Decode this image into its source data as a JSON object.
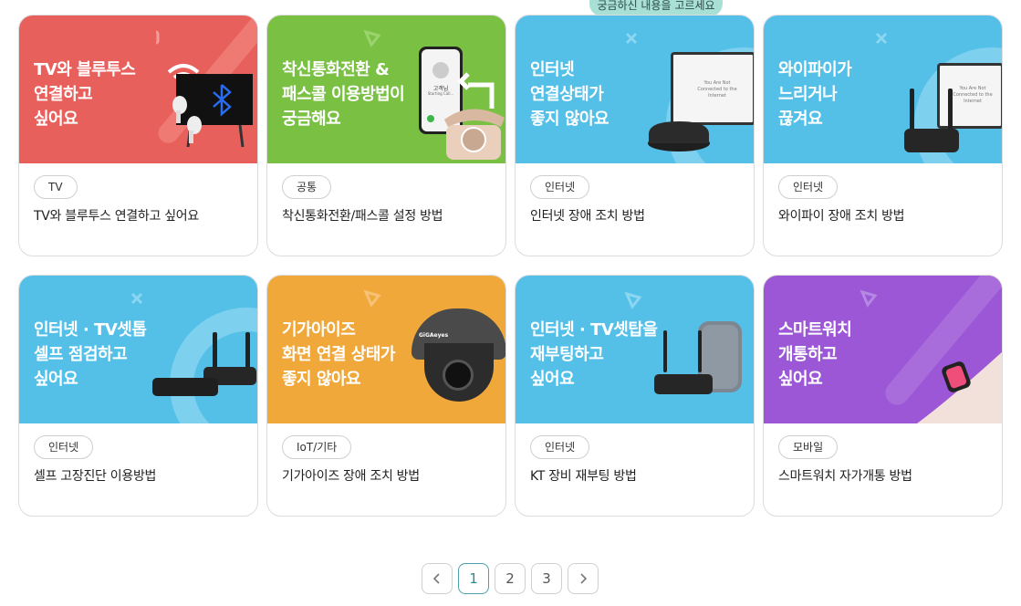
{
  "tooltip": {
    "text": "궁금하신 내용을 고르세요"
  },
  "cards": [
    {
      "title": "TV와 블루투스\n연결하고\n싶어요",
      "tag": "TV",
      "desc": "TV와 블루투스 연결하고 싶어요",
      "bg": "#e8605b"
    },
    {
      "title": "착신통화전환 &\n패스콜 이용방법이\n궁금해요",
      "tag": "공통",
      "desc": "착신통화전환/패스콜 설정 방법",
      "bg": "#79c043",
      "phone_name": "고객님",
      "phone_status": "Starting Call..."
    },
    {
      "title": "인터넷\n연결상태가\n좋지 않아요",
      "tag": "인터넷",
      "desc": "인터넷 장애 조치 방법",
      "bg": "#54c0e8",
      "screen_text": "You Are Not Connected to the Internet"
    },
    {
      "title": "와이파이가\n느리거나\n끊겨요",
      "tag": "인터넷",
      "desc": "와이파이 장애 조치 방법",
      "bg": "#54c0e8",
      "screen_text": "You Are Not Connected to the Internet"
    },
    {
      "title": "인터넷 · TV셋톱\n셀프 점검하고\n싶어요",
      "tag": "인터넷",
      "desc": "셀프 고장진단 이용방법",
      "bg": "#54c0e8"
    },
    {
      "title": "기가아이즈\n화면 연결 상태가\n좋지 않아요",
      "tag": "IoT/기타",
      "desc": "기가아이즈 장애 조치 방법",
      "bg": "#f0a83a",
      "camera_brand": "GiGAeyes"
    },
    {
      "title": "인터넷 · TV셋탑을\n재부팅하고\n싶어요",
      "tag": "인터넷",
      "desc": "KT 장비 재부팅 방법",
      "bg": "#54c0e8"
    },
    {
      "title": "스마트워치\n개통하고\n싶어요",
      "tag": "모바일",
      "desc": "스마트워치 자가개통 방법",
      "bg": "#9b57d6"
    }
  ],
  "pagination": {
    "prev": "prev",
    "pages": [
      "1",
      "2",
      "3"
    ],
    "current": "1",
    "next": "next"
  }
}
